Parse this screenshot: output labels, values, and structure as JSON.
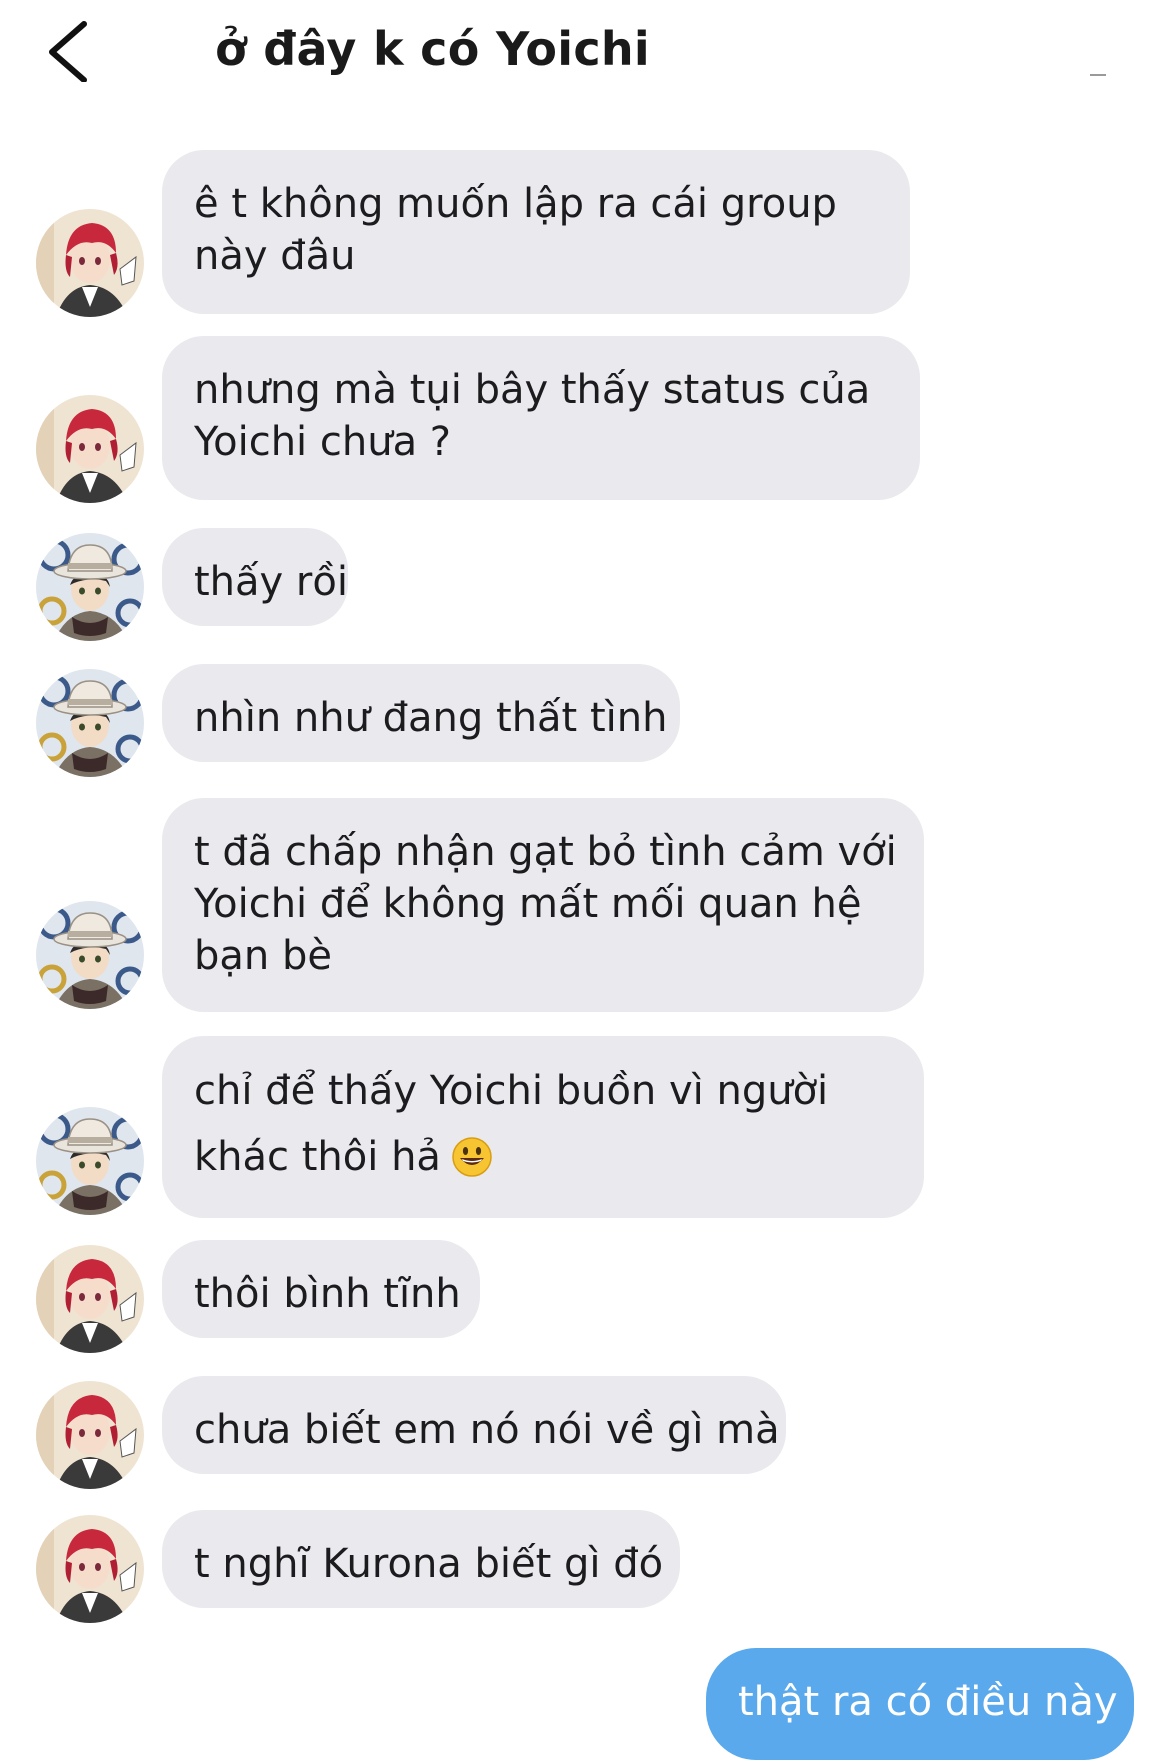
{
  "header": {
    "title": "ở đây k có Yoichi",
    "back_icon": "chevron-left-icon"
  },
  "messages": [
    {
      "sender": "red-hair",
      "lines": [
        "ê t không muốn lập ra cái group",
        "này đâu"
      ]
    },
    {
      "sender": "red-hair",
      "lines": [
        "nhưng mà tụi bây thấy status của",
        "Yoichi chưa ?"
      ]
    },
    {
      "sender": "hat",
      "lines": [
        "thấy rồi"
      ]
    },
    {
      "sender": "hat",
      "lines": [
        "nhìn như đang thất tình"
      ]
    },
    {
      "sender": "hat",
      "lines": [
        "t đã chấp nhận gạt bỏ tình cảm với",
        "Yoichi để không mất mối quan hệ",
        "bạn bè"
      ]
    },
    {
      "sender": "hat",
      "lines": [
        "chỉ để thấy Yoichi buồn vì người",
        "khác thôi hả"
      ],
      "emoji": "grinning-face-emoji"
    },
    {
      "sender": "red-hair",
      "lines": [
        "thôi bình tĩnh"
      ]
    },
    {
      "sender": "red-hair",
      "lines": [
        "chưa biết em nó nói về gì mà"
      ]
    },
    {
      "sender": "red-hair",
      "lines": [
        "t nghĩ Kurona biết gì đó"
      ]
    }
  ],
  "my_message": {
    "text": "thật ra có điều này"
  },
  "colors": {
    "incoming_bubble": "#e9e9ee",
    "outgoing_bubble": "#5aa9ec",
    "outgoing_text": "#ffffff"
  }
}
